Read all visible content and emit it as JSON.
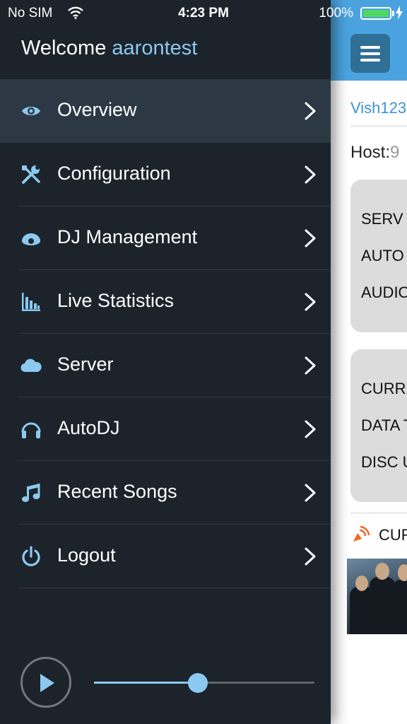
{
  "status_bar": {
    "carrier": "No SIM",
    "time": "4:23 PM",
    "battery_percent": "100%"
  },
  "drawer": {
    "welcome_prefix": "Welcome",
    "username": "aarontest",
    "menu": [
      {
        "label": "Overview",
        "icon": "eye-icon",
        "active": true
      },
      {
        "label": "Configuration",
        "icon": "tools-icon",
        "active": false
      },
      {
        "label": "DJ Management",
        "icon": "dj-icon",
        "active": false
      },
      {
        "label": "Live Statistics",
        "icon": "bar-chart-icon",
        "active": false
      },
      {
        "label": "Server",
        "icon": "cloud-icon",
        "active": false
      },
      {
        "label": "AutoDJ",
        "icon": "headphones-icon",
        "active": false
      },
      {
        "label": "Recent Songs",
        "icon": "music-note-icon",
        "active": false
      },
      {
        "label": "Logout",
        "icon": "power-icon",
        "active": false
      }
    ],
    "player": {
      "state": "paused",
      "volume": 0.47
    }
  },
  "main": {
    "station_name": "Vish123",
    "host_label": "Host:",
    "host_value": "9",
    "server_card": [
      "SERV",
      "AUTO",
      "AUDIO"
    ],
    "stats_card": [
      "CURR",
      "DATA T",
      "DISC U"
    ],
    "now_playing_label": "CUR"
  },
  "colors": {
    "drawer_bg": "#1c232b",
    "active_item_bg": "#2c3945",
    "accent": "#8cc9f0",
    "header_blue": "#4aa3df"
  }
}
